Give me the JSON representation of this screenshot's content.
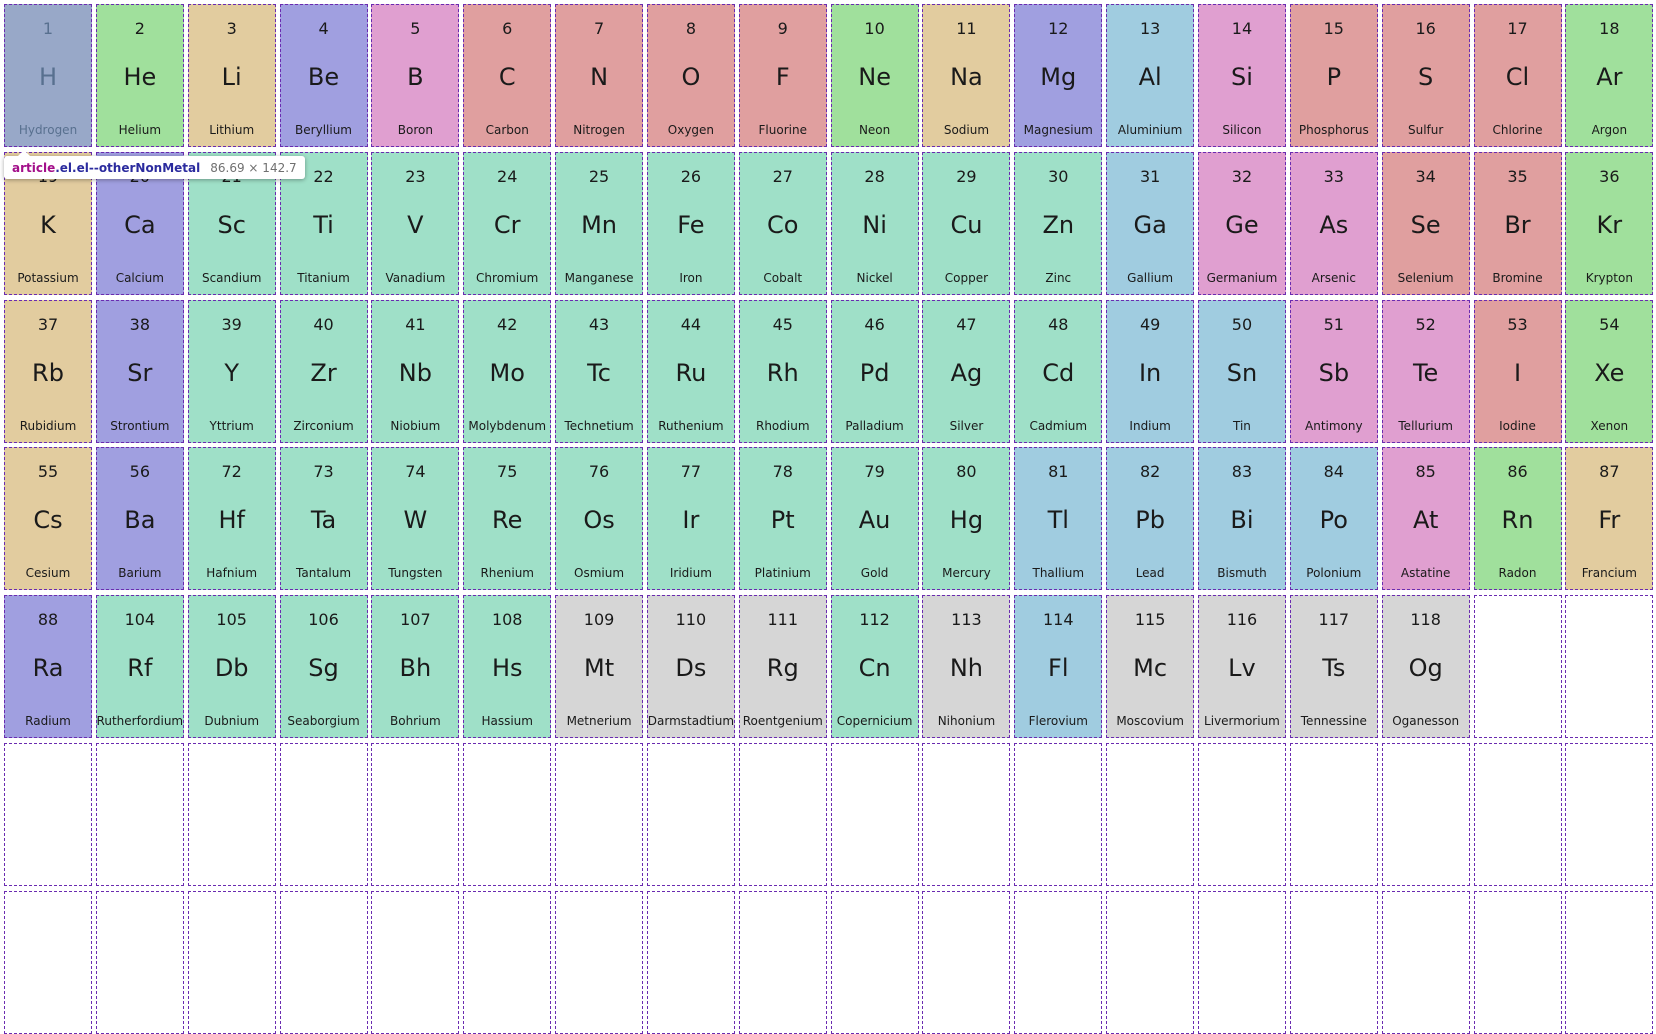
{
  "category_colors": {
    "otherNonMetal": "#98a8c8",
    "nobleGas": "#a0e09c",
    "alkaliMetal": "#e2cc9f",
    "alkalineEarthMetal": "#a09fe0",
    "metalloid": "#e09fd0",
    "reactiveNonMetal": "#e09f9f",
    "postTransitionMetal": "#a0cce0",
    "transitionMetal": "#9fe0c8",
    "unknown": "#d6d6d6"
  },
  "elements": [
    {
      "number": "1",
      "symbol": "H",
      "name": "Hydrogen",
      "category": "otherNonMetal",
      "inspected": true
    },
    {
      "number": "2",
      "symbol": "He",
      "name": "Helium",
      "category": "nobleGas"
    },
    {
      "number": "3",
      "symbol": "Li",
      "name": "Lithium",
      "category": "alkaliMetal"
    },
    {
      "number": "4",
      "symbol": "Be",
      "name": "Beryllium",
      "category": "alkalineEarthMetal"
    },
    {
      "number": "5",
      "symbol": "B",
      "name": "Boron",
      "category": "metalloid"
    },
    {
      "number": "6",
      "symbol": "C",
      "name": "Carbon",
      "category": "reactiveNonMetal"
    },
    {
      "number": "7",
      "symbol": "N",
      "name": "Nitrogen",
      "category": "reactiveNonMetal"
    },
    {
      "number": "8",
      "symbol": "O",
      "name": "Oxygen",
      "category": "reactiveNonMetal"
    },
    {
      "number": "9",
      "symbol": "F",
      "name": "Fluorine",
      "category": "reactiveNonMetal"
    },
    {
      "number": "10",
      "symbol": "Ne",
      "name": "Neon",
      "category": "nobleGas"
    },
    {
      "number": "11",
      "symbol": "Na",
      "name": "Sodium",
      "category": "alkaliMetal"
    },
    {
      "number": "12",
      "symbol": "Mg",
      "name": "Magnesium",
      "category": "alkalineEarthMetal"
    },
    {
      "number": "13",
      "symbol": "Al",
      "name": "Aluminium",
      "category": "postTransitionMetal"
    },
    {
      "number": "14",
      "symbol": "Si",
      "name": "Silicon",
      "category": "metalloid"
    },
    {
      "number": "15",
      "symbol": "P",
      "name": "Phosphorus",
      "category": "reactiveNonMetal"
    },
    {
      "number": "16",
      "symbol": "S",
      "name": "Sulfur",
      "category": "reactiveNonMetal"
    },
    {
      "number": "17",
      "symbol": "Cl",
      "name": "Chlorine",
      "category": "reactiveNonMetal"
    },
    {
      "number": "18",
      "symbol": "Ar",
      "name": "Argon",
      "category": "nobleGas"
    },
    {
      "number": "19",
      "symbol": "K",
      "name": "Potassium",
      "category": "alkaliMetal"
    },
    {
      "number": "20",
      "symbol": "Ca",
      "name": "Calcium",
      "category": "alkalineEarthMetal"
    },
    {
      "number": "21",
      "symbol": "Sc",
      "name": "Scandium",
      "category": "transitionMetal"
    },
    {
      "number": "22",
      "symbol": "Ti",
      "name": "Titanium",
      "category": "transitionMetal"
    },
    {
      "number": "23",
      "symbol": "V",
      "name": "Vanadium",
      "category": "transitionMetal"
    },
    {
      "number": "24",
      "symbol": "Cr",
      "name": "Chromium",
      "category": "transitionMetal"
    },
    {
      "number": "25",
      "symbol": "Mn",
      "name": "Manganese",
      "category": "transitionMetal"
    },
    {
      "number": "26",
      "symbol": "Fe",
      "name": "Iron",
      "category": "transitionMetal"
    },
    {
      "number": "27",
      "symbol": "Co",
      "name": "Cobalt",
      "category": "transitionMetal"
    },
    {
      "number": "28",
      "symbol": "Ni",
      "name": "Nickel",
      "category": "transitionMetal"
    },
    {
      "number": "29",
      "symbol": "Cu",
      "name": "Copper",
      "category": "transitionMetal"
    },
    {
      "number": "30",
      "symbol": "Zn",
      "name": "Zinc",
      "category": "transitionMetal"
    },
    {
      "number": "31",
      "symbol": "Ga",
      "name": "Gallium",
      "category": "postTransitionMetal"
    },
    {
      "number": "32",
      "symbol": "Ge",
      "name": "Germanium",
      "category": "metalloid"
    },
    {
      "number": "33",
      "symbol": "As",
      "name": "Arsenic",
      "category": "metalloid"
    },
    {
      "number": "34",
      "symbol": "Se",
      "name": "Selenium",
      "category": "reactiveNonMetal"
    },
    {
      "number": "35",
      "symbol": "Br",
      "name": "Bromine",
      "category": "reactiveNonMetal"
    },
    {
      "number": "36",
      "symbol": "Kr",
      "name": "Krypton",
      "category": "nobleGas"
    },
    {
      "number": "37",
      "symbol": "Rb",
      "name": "Rubidium",
      "category": "alkaliMetal"
    },
    {
      "number": "38",
      "symbol": "Sr",
      "name": "Strontium",
      "category": "alkalineEarthMetal"
    },
    {
      "number": "39",
      "symbol": "Y",
      "name": "Yttrium",
      "category": "transitionMetal"
    },
    {
      "number": "40",
      "symbol": "Zr",
      "name": "Zirconium",
      "category": "transitionMetal"
    },
    {
      "number": "41",
      "symbol": "Nb",
      "name": "Niobium",
      "category": "transitionMetal"
    },
    {
      "number": "42",
      "symbol": "Mo",
      "name": "Molybdenum",
      "category": "transitionMetal"
    },
    {
      "number": "43",
      "symbol": "Tc",
      "name": "Technetium",
      "category": "transitionMetal"
    },
    {
      "number": "44",
      "symbol": "Ru",
      "name": "Ruthenium",
      "category": "transitionMetal"
    },
    {
      "number": "45",
      "symbol": "Rh",
      "name": "Rhodium",
      "category": "transitionMetal"
    },
    {
      "number": "46",
      "symbol": "Pd",
      "name": "Palladium",
      "category": "transitionMetal"
    },
    {
      "number": "47",
      "symbol": "Ag",
      "name": "Silver",
      "category": "transitionMetal"
    },
    {
      "number": "48",
      "symbol": "Cd",
      "name": "Cadmium",
      "category": "transitionMetal"
    },
    {
      "number": "49",
      "symbol": "In",
      "name": "Indium",
      "category": "postTransitionMetal"
    },
    {
      "number": "50",
      "symbol": "Sn",
      "name": "Tin",
      "category": "postTransitionMetal"
    },
    {
      "number": "51",
      "symbol": "Sb",
      "name": "Antimony",
      "category": "metalloid"
    },
    {
      "number": "52",
      "symbol": "Te",
      "name": "Tellurium",
      "category": "metalloid"
    },
    {
      "number": "53",
      "symbol": "I",
      "name": "Iodine",
      "category": "reactiveNonMetal"
    },
    {
      "number": "54",
      "symbol": "Xe",
      "name": "Xenon",
      "category": "nobleGas"
    },
    {
      "number": "55",
      "symbol": "Cs",
      "name": "Cesium",
      "category": "alkaliMetal"
    },
    {
      "number": "56",
      "symbol": "Ba",
      "name": "Barium",
      "category": "alkalineEarthMetal"
    },
    {
      "number": "72",
      "symbol": "Hf",
      "name": "Hafnium",
      "category": "transitionMetal"
    },
    {
      "number": "73",
      "symbol": "Ta",
      "name": "Tantalum",
      "category": "transitionMetal"
    },
    {
      "number": "74",
      "symbol": "W",
      "name": "Tungsten",
      "category": "transitionMetal"
    },
    {
      "number": "75",
      "symbol": "Re",
      "name": "Rhenium",
      "category": "transitionMetal"
    },
    {
      "number": "76",
      "symbol": "Os",
      "name": "Osmium",
      "category": "transitionMetal"
    },
    {
      "number": "77",
      "symbol": "Ir",
      "name": "Iridium",
      "category": "transitionMetal"
    },
    {
      "number": "78",
      "symbol": "Pt",
      "name": "Platinium",
      "category": "transitionMetal"
    },
    {
      "number": "79",
      "symbol": "Au",
      "name": "Gold",
      "category": "transitionMetal"
    },
    {
      "number": "80",
      "symbol": "Hg",
      "name": "Mercury",
      "category": "transitionMetal"
    },
    {
      "number": "81",
      "symbol": "Tl",
      "name": "Thallium",
      "category": "postTransitionMetal"
    },
    {
      "number": "82",
      "symbol": "Pb",
      "name": "Lead",
      "category": "postTransitionMetal"
    },
    {
      "number": "83",
      "symbol": "Bi",
      "name": "Bismuth",
      "category": "postTransitionMetal"
    },
    {
      "number": "84",
      "symbol": "Po",
      "name": "Polonium",
      "category": "postTransitionMetal"
    },
    {
      "number": "85",
      "symbol": "At",
      "name": "Astatine",
      "category": "metalloid"
    },
    {
      "number": "86",
      "symbol": "Rn",
      "name": "Radon",
      "category": "nobleGas"
    },
    {
      "number": "87",
      "symbol": "Fr",
      "name": "Francium",
      "category": "alkaliMetal"
    },
    {
      "number": "88",
      "symbol": "Ra",
      "name": "Radium",
      "category": "alkalineEarthMetal"
    },
    {
      "number": "104",
      "symbol": "Rf",
      "name": "Rutherfordium",
      "category": "transitionMetal"
    },
    {
      "number": "105",
      "symbol": "Db",
      "name": "Dubnium",
      "category": "transitionMetal"
    },
    {
      "number": "106",
      "symbol": "Sg",
      "name": "Seaborgium",
      "category": "transitionMetal"
    },
    {
      "number": "107",
      "symbol": "Bh",
      "name": "Bohrium",
      "category": "transitionMetal"
    },
    {
      "number": "108",
      "symbol": "Hs",
      "name": "Hassium",
      "category": "transitionMetal"
    },
    {
      "number": "109",
      "symbol": "Mt",
      "name": "Metnerium",
      "category": "unknown"
    },
    {
      "number": "110",
      "symbol": "Ds",
      "name": "Darmstadtium",
      "category": "unknown"
    },
    {
      "number": "111",
      "symbol": "Rg",
      "name": "Roentgenium",
      "category": "unknown"
    },
    {
      "number": "112",
      "symbol": "Cn",
      "name": "Copernicium",
      "category": "transitionMetal"
    },
    {
      "number": "113",
      "symbol": "Nh",
      "name": "Nihonium",
      "category": "unknown"
    },
    {
      "number": "114",
      "symbol": "Fl",
      "name": "Flerovium",
      "category": "postTransitionMetal"
    },
    {
      "number": "115",
      "symbol": "Mc",
      "name": "Moscovium",
      "category": "unknown"
    },
    {
      "number": "116",
      "symbol": "Lv",
      "name": "Livermorium",
      "category": "unknown"
    },
    {
      "number": "117",
      "symbol": "Ts",
      "name": "Tennessine",
      "category": "unknown"
    },
    {
      "number": "118",
      "symbol": "Og",
      "name": "Oganesson",
      "category": "unknown"
    }
  ],
  "empty_cell_count": 38,
  "inspector": {
    "tag": "article",
    "classes": ".el.el--otherNonMetal",
    "dimensions": "86.69 × 142.7"
  }
}
